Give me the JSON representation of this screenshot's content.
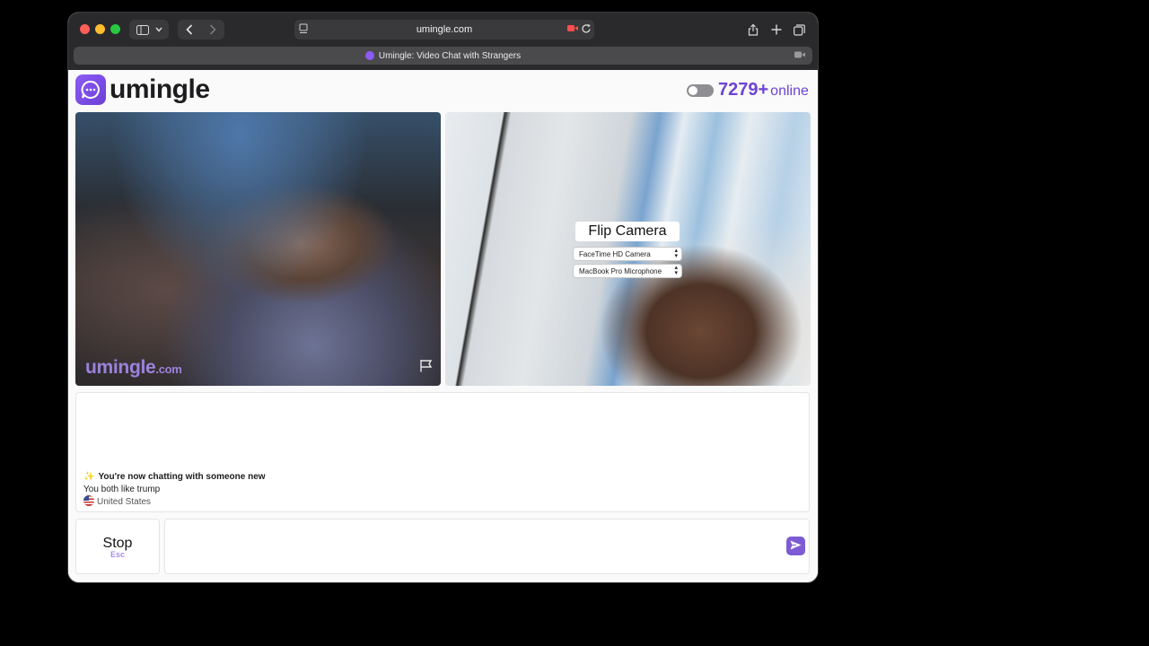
{
  "browser": {
    "url": "umingle.com",
    "tab_title": "Umingle: Video Chat with Strangers"
  },
  "header": {
    "logo_text": "umingle",
    "online_count": "7279+",
    "online_label": "online"
  },
  "video_left": {
    "watermark_main": "umingle",
    "watermark_suffix": ".com"
  },
  "video_right": {
    "flip_button": "Flip Camera",
    "camera_select": "FaceTime HD Camera",
    "microphone_select": "MacBook Pro Microphone"
  },
  "chat": {
    "new_chat_message": "You're now chatting with someone new",
    "interest_message": "You both like trump",
    "country": "United States"
  },
  "controls": {
    "stop_label": "Stop",
    "stop_shortcut": "Esc"
  },
  "colors": {
    "accent": "#7c5bd4",
    "online_text": "#6d43d4"
  }
}
